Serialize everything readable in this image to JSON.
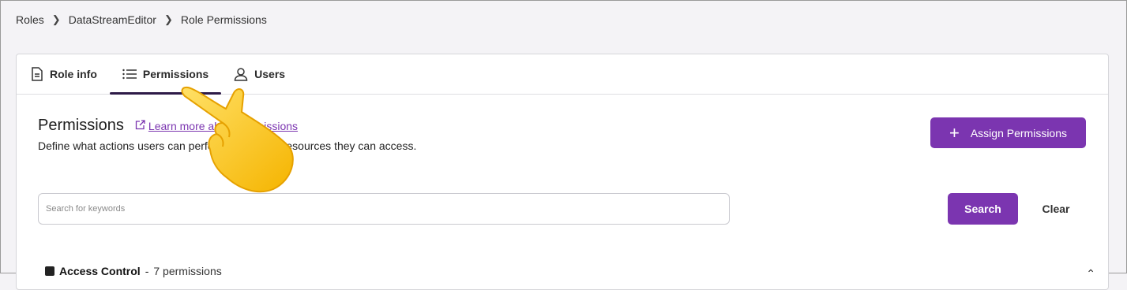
{
  "breadcrumb": {
    "items": [
      "Roles",
      "DataStreamEditor",
      "Role Permissions"
    ],
    "separator": ">"
  },
  "tabs": [
    {
      "label": "Role info",
      "icon": "document-icon",
      "active": false
    },
    {
      "label": "Permissions",
      "icon": "list-icon",
      "active": true
    },
    {
      "label": "Users",
      "icon": "user-icon",
      "active": false
    }
  ],
  "section": {
    "title": "Permissions",
    "learn_more": "Learn more about permissions",
    "description": "Define what actions users can perform and which resources they can access."
  },
  "assign_button": {
    "label": "Assign Permissions",
    "icon": "plus-icon"
  },
  "search": {
    "placeholder": "Search for keywords",
    "value": ""
  },
  "search_button": {
    "label": "Search"
  },
  "clear_button": {
    "label": "Clear"
  },
  "group": {
    "name": "Access Control",
    "separator": "-",
    "count": "7 permissions"
  },
  "colors": {
    "accent": "#7b35b0",
    "tab_indicator": "#2d1a47",
    "background": "#f4f3f6"
  }
}
